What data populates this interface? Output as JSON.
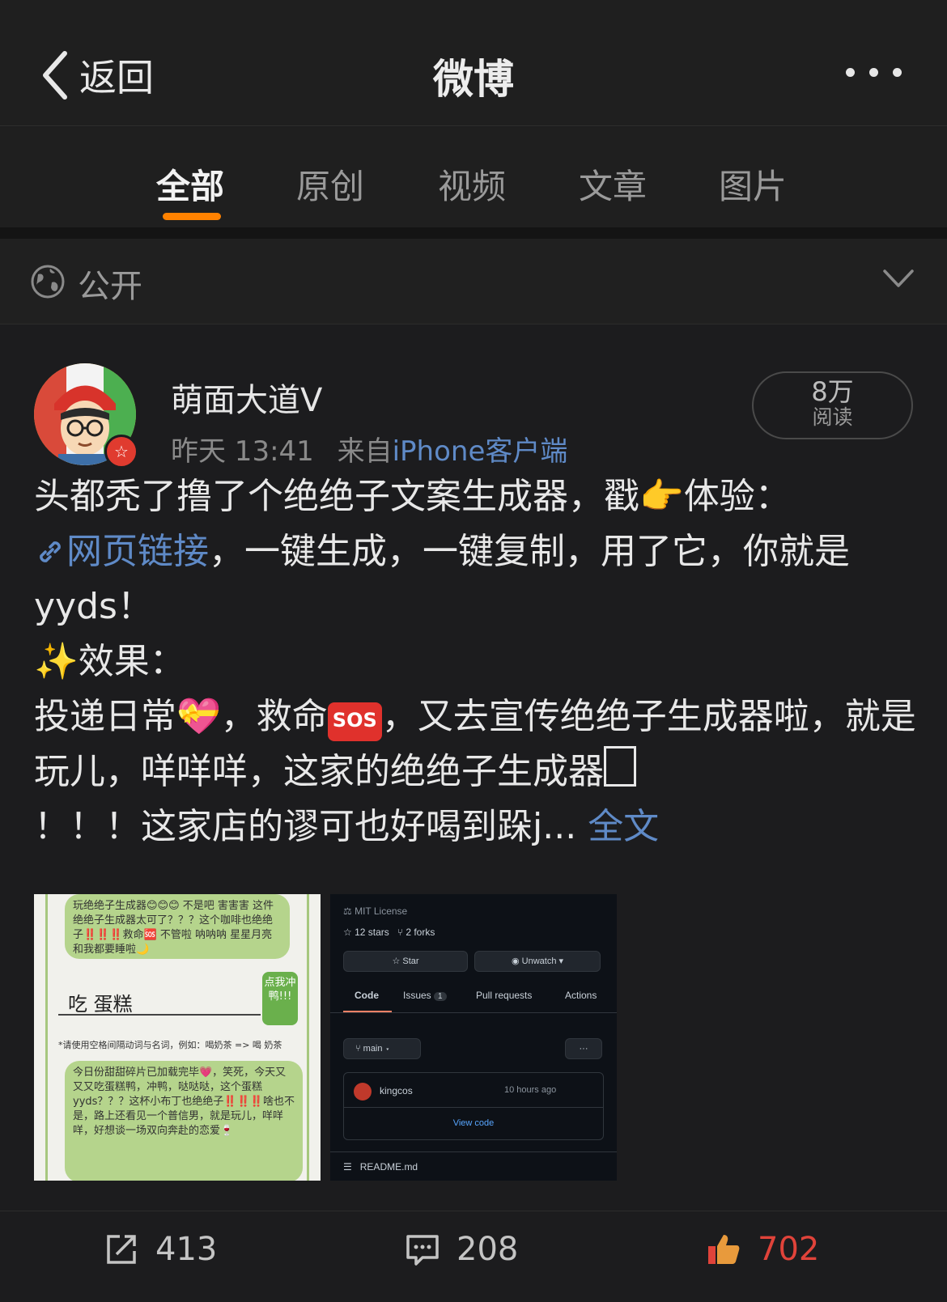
{
  "nav": {
    "back_label": "返回",
    "title": "微博"
  },
  "tabs": [
    {
      "label": "全部",
      "active": true
    },
    {
      "label": "原创",
      "active": false
    },
    {
      "label": "视频",
      "active": false
    },
    {
      "label": "文章",
      "active": false
    },
    {
      "label": "图片",
      "active": false
    }
  ],
  "accent_color": "#ff8200",
  "link_color": "#5f8ac7",
  "visibility": {
    "label": "公开"
  },
  "post": {
    "user_name": "萌面大道Ⅴ",
    "time": "昨天 13:41",
    "source_prefix": "来自",
    "source": "iPhone客户端",
    "reads_count": "8万",
    "reads_label": "阅读",
    "text": {
      "line1": "头都秃了撸了个绝绝子文案生成器，戳",
      "line1_tail": "体验：",
      "link_label": "网页链接",
      "line2_tail": "，一键生成，一键复制，用了它，你就是yyds！",
      "effect": "效果：",
      "line4a": "投递日常",
      "line4b": "，救命",
      "line4c": "，又去宣传绝绝子生成器啦，就是玩儿，咩咩咩，这家的绝绝子生成器",
      "line5": "！！！这家店的谬可也好喝到跺j...",
      "full_text_link": "全文"
    },
    "emoji": {
      "point": "👉",
      "sparkles": "✨",
      "heart": "💝",
      "sos": "SOS"
    },
    "image1": {
      "bubble1": "玩绝绝子生成器😊😊😊 不是吧 害害害 这件绝绝子生成器太可了？？？这个咖啡也绝绝子‼️‼️‼️救命🆘 不管啦 呐呐呐 星星月亮和我都要睡啦🌙",
      "input_value": "吃 蛋糕",
      "button_label": "点我冲鸭!!!",
      "hint": "*请使用空格间隔动词与名词，例如：喝奶茶 => 喝 奶茶",
      "bubble2": "今日份甜甜碎片已加载完毕💗，笑死，今天又又又吃蛋糕鸭，冲鸭，哒哒哒，这个蛋糕yyds？？？这杯小布丁也绝绝子‼️‼️‼️啥也不是，路上还看见一个普信男，就是玩儿，咩咩咩，好想谈一场双向奔赴的恋爱🍷"
    },
    "image2": {
      "license": "MIT License",
      "stars": "12 stars",
      "forks": "2 forks",
      "star_btn": "Star",
      "unwatch_btn": "Unwatch",
      "tabs": [
        "Code",
        "Issues",
        "Pull requests",
        "Actions"
      ],
      "issues_count": "1",
      "branch": "main",
      "committer": "kingcos",
      "commit_time": "10 hours ago",
      "view_code": "View code",
      "readme": "README.md"
    },
    "repost_count": "413",
    "comment_count": "208",
    "like_count": "702"
  }
}
